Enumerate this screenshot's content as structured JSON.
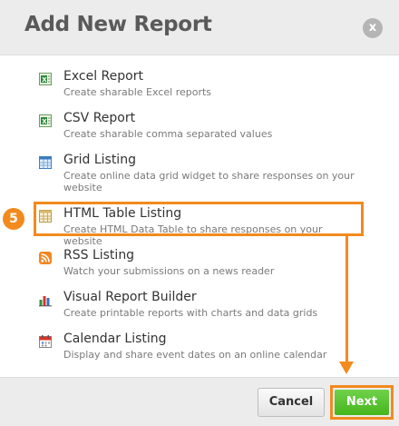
{
  "dialog": {
    "title": "Add New Report",
    "close_label": "x"
  },
  "reports": [
    {
      "icon": "excel-icon",
      "label": "Excel Report",
      "description": "Create sharable Excel reports"
    },
    {
      "icon": "csv-icon",
      "label": "CSV Report",
      "description": "Create sharable comma separated values"
    },
    {
      "icon": "grid-icon",
      "label": "Grid Listing",
      "description": "Create online data grid widget to share responses on your website"
    },
    {
      "icon": "html-table-icon",
      "label": "HTML Table Listing",
      "description": "Create HTML Data Table to share responses on your website"
    },
    {
      "icon": "rss-icon",
      "label": "RSS Listing",
      "description": "Watch your submissions on a news reader"
    },
    {
      "icon": "bar-chart-icon",
      "label": "Visual Report Builder",
      "description": "Create printable reports with charts and data grids"
    },
    {
      "icon": "calendar-icon",
      "label": "Calendar Listing",
      "description": "Display and share event dates on an online calendar"
    }
  ],
  "annotation": {
    "step_number": "5",
    "accent_color": "#f28a1e"
  },
  "footer": {
    "cancel_label": "Cancel",
    "next_label": "Next",
    "next_color": "#4cb920"
  }
}
